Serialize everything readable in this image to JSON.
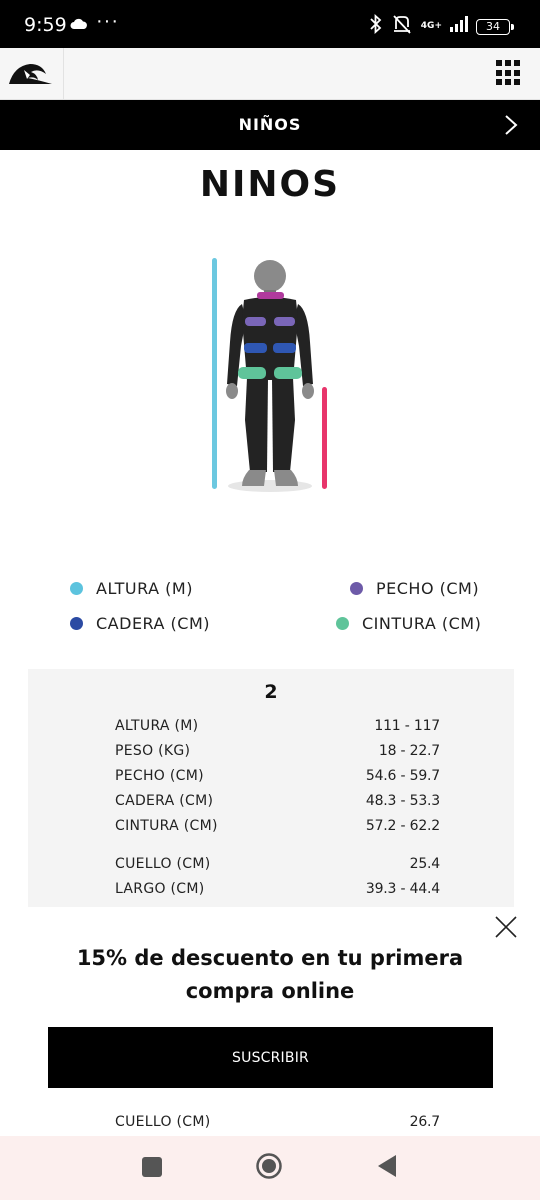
{
  "status_bar": {
    "time": "9:59",
    "dots": "···",
    "network": "4G+",
    "battery": "34"
  },
  "header": {
    "logo_icon": "quiksilver-wave-logo",
    "menu_icon": "grid-menu-icon"
  },
  "category_bar": {
    "title": "NIÑOS",
    "next_icon": "chevron-right-icon"
  },
  "page": {
    "title": "NINOS"
  },
  "legend": [
    {
      "label": "ALTURA (M)",
      "color": "#5cc3de"
    },
    {
      "label": "PECHO (CM)",
      "color": "#6d5aa8"
    },
    {
      "label": "CADERA (CM)",
      "color": "#2b4aa3"
    },
    {
      "label": "CINTURA (CM)",
      "color": "#5fc49a"
    }
  ],
  "size_card": {
    "size": "2",
    "rows": [
      {
        "label": "ALTURA (M)",
        "value": "111 - 117"
      },
      {
        "label": "PESO (KG)",
        "value": "18 - 22.7"
      },
      {
        "label": "PECHO (CM)",
        "value": "54.6 - 59.7"
      },
      {
        "label": "CADERA (CM)",
        "value": "48.3 - 53.3"
      },
      {
        "label": "CINTURA (CM)",
        "value": "57.2 - 62.2"
      },
      {
        "label": "CUELLO (CM)",
        "value": "25.4"
      },
      {
        "label": "LARGO (CM)",
        "value": "39.3 - 44.4"
      }
    ],
    "peek_row": {
      "label": "CUELLO (CM)",
      "value": "26.7"
    }
  },
  "promo": {
    "line1": "15% de descuento en tu primera",
    "line2": "compra online",
    "button": "SUSCRIBIR"
  },
  "colors": {
    "accent_black": "#000000",
    "altura_bar": "#6cc8e0",
    "largo_bar": "#e8356b"
  }
}
